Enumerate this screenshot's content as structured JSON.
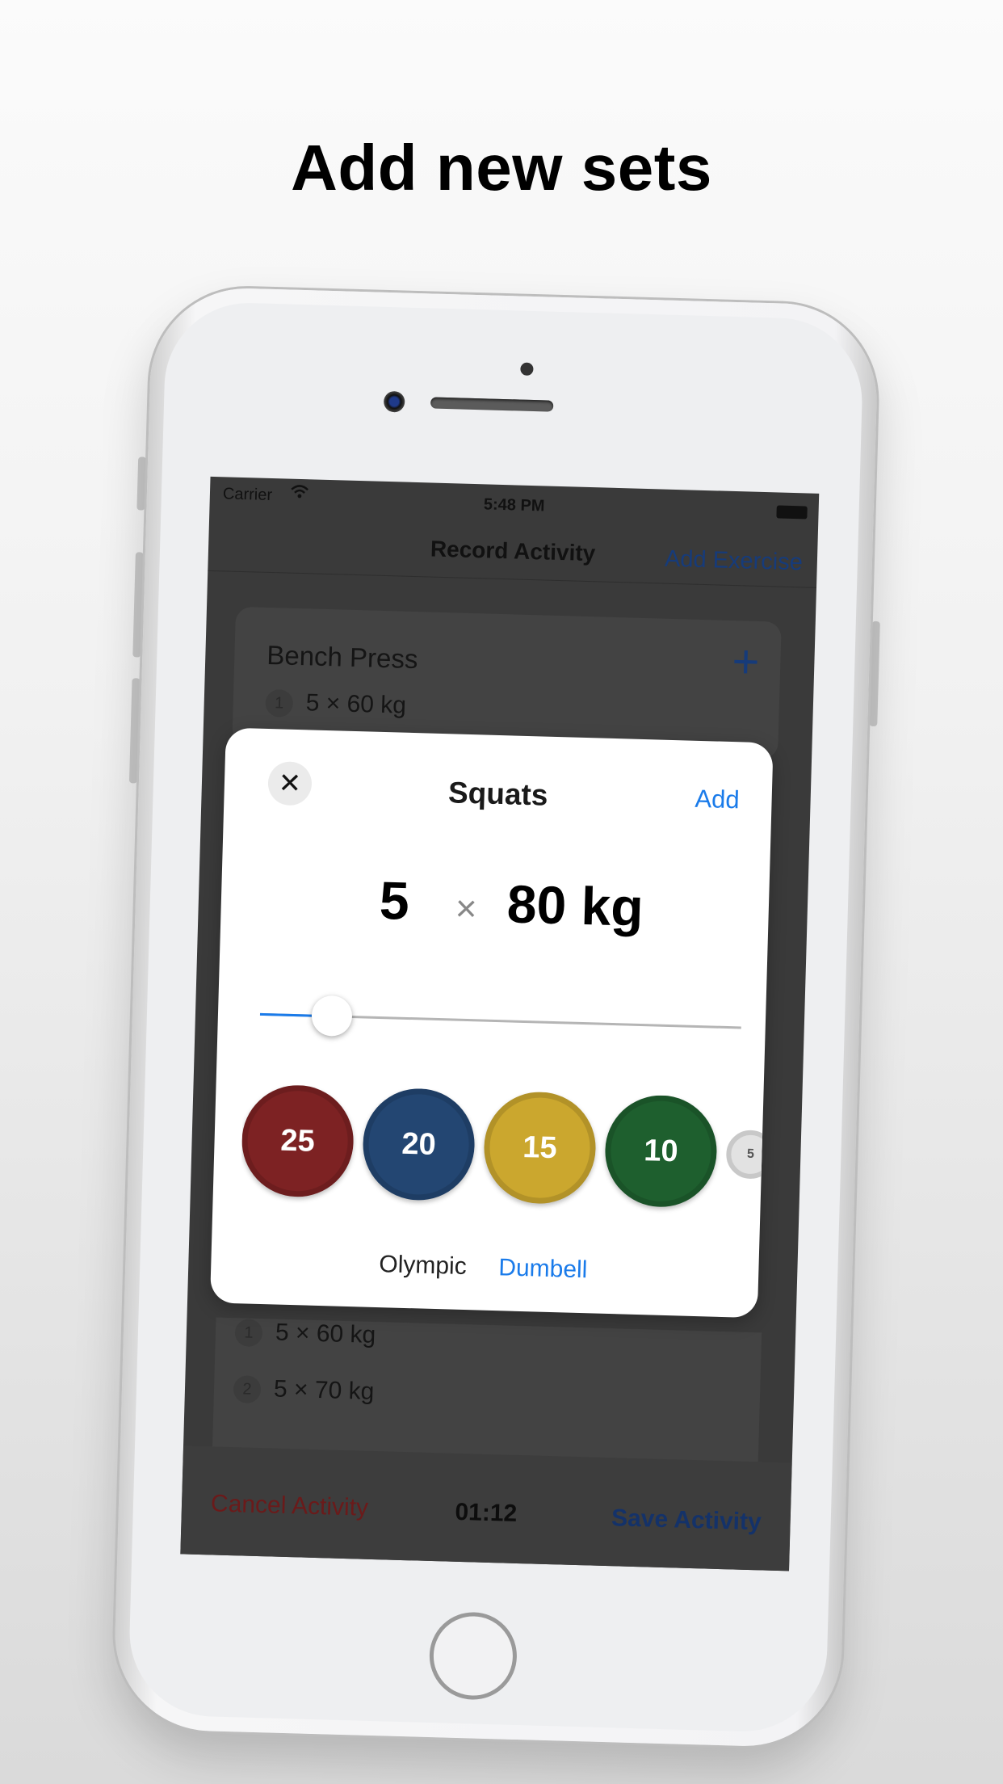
{
  "headline": "Add new sets",
  "status_bar": {
    "carrier": "Carrier",
    "time": "5:48 PM"
  },
  "navbar": {
    "title": "Record Activity",
    "right_button": "Add Exercise"
  },
  "workout": {
    "exercise1": {
      "name": "Bench Press",
      "sets": [
        {
          "index": "1",
          "text": "5 × 60 kg"
        }
      ]
    },
    "exercise2": {
      "sets": [
        {
          "index": "1",
          "text": "5 × 60 kg"
        },
        {
          "index": "2",
          "text": "5 × 70 kg"
        }
      ]
    }
  },
  "bottom_bar": {
    "cancel": "Cancel Activity",
    "timer": "01:12",
    "save": "Save Activity"
  },
  "modal": {
    "title": "Squats",
    "add_label": "Add",
    "reps": "5",
    "times_symbol": "×",
    "weight": "80 kg",
    "slider_value": 0.15,
    "plates": [
      {
        "label": "25",
        "color": "#7d2223"
      },
      {
        "label": "20",
        "color": "#234672"
      },
      {
        "label": "15",
        "color": "#cba72e"
      },
      {
        "label": "10",
        "color": "#1e5f2e"
      },
      {
        "label": "5",
        "color": "#e2e2e2"
      }
    ],
    "tabs": {
      "olympic": "Olympic",
      "dumbell": "Dumbell"
    }
  },
  "icons": {
    "close": "close-icon",
    "plus": "plus-icon",
    "wifi": "wifi-icon",
    "battery": "battery-icon"
  },
  "colors": {
    "accent": "#1a7bea"
  }
}
